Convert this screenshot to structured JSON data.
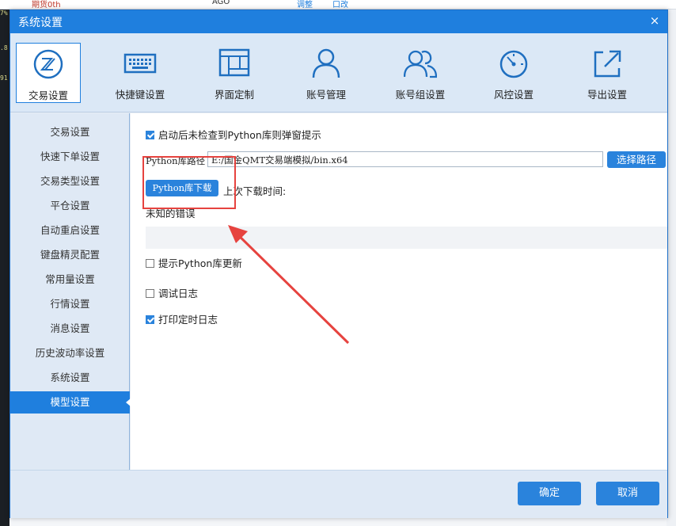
{
  "background": {
    "top_text": "期货0th",
    "top_text2": "AGO",
    "top_text3": "调整",
    "top_text4": "口改",
    "left_numbers": [
      "7%",
      ".8",
      "91"
    ]
  },
  "dialog": {
    "title": "系统设置",
    "close_icon": "×",
    "toolbar": [
      {
        "key": "trade",
        "label": "交易设置",
        "icon": "trade-settings-icon",
        "active": true
      },
      {
        "key": "hotkey",
        "label": "快捷键设置",
        "icon": "keyboard-icon",
        "active": false
      },
      {
        "key": "ui",
        "label": "界面定制",
        "icon": "layout-icon",
        "active": false
      },
      {
        "key": "account",
        "label": "账号管理",
        "icon": "user-icon",
        "active": false
      },
      {
        "key": "account_group",
        "label": "账号组设置",
        "icon": "user-group-icon",
        "active": false
      },
      {
        "key": "risk",
        "label": "风控设置",
        "icon": "gauge-icon",
        "active": false
      },
      {
        "key": "export",
        "label": "导出设置",
        "icon": "export-icon",
        "active": false
      }
    ],
    "sidebar": [
      {
        "label": "交易设置",
        "active": false
      },
      {
        "label": "快速下单设置",
        "active": false
      },
      {
        "label": "交易类型设置",
        "active": false
      },
      {
        "label": "平仓设置",
        "active": false
      },
      {
        "label": "自动重启设置",
        "active": false
      },
      {
        "label": "键盘精灵配置",
        "active": false
      },
      {
        "label": "常用量设置",
        "active": false
      },
      {
        "label": "行情设置",
        "active": false
      },
      {
        "label": "消息设置",
        "active": false
      },
      {
        "label": "历史波动率设置",
        "active": false
      },
      {
        "label": "系统设置",
        "active": false
      },
      {
        "label": "模型设置",
        "active": true
      }
    ],
    "content": {
      "startup_check": {
        "label": "启动后未检查到Python库则弹窗提示",
        "checked": true
      },
      "path_label": "Python库路径",
      "path_value": "E:/国金QMT交易端模拟/bin.x64",
      "browse_button": "选择路径",
      "download_button": "Python库下载",
      "last_download_label": "上次下载时间:",
      "error_text": "未知的错误",
      "prompt_update": {
        "label": "提示Python库更新",
        "checked": false
      },
      "debug_log": {
        "label": "调试日志",
        "checked": false
      },
      "print_timed_log": {
        "label": "打印定时日志",
        "checked": true
      }
    },
    "footer": {
      "ok": "确定",
      "cancel": "取消"
    },
    "colors": {
      "accent": "#1f7fde",
      "annotation": "#e6433f"
    }
  }
}
